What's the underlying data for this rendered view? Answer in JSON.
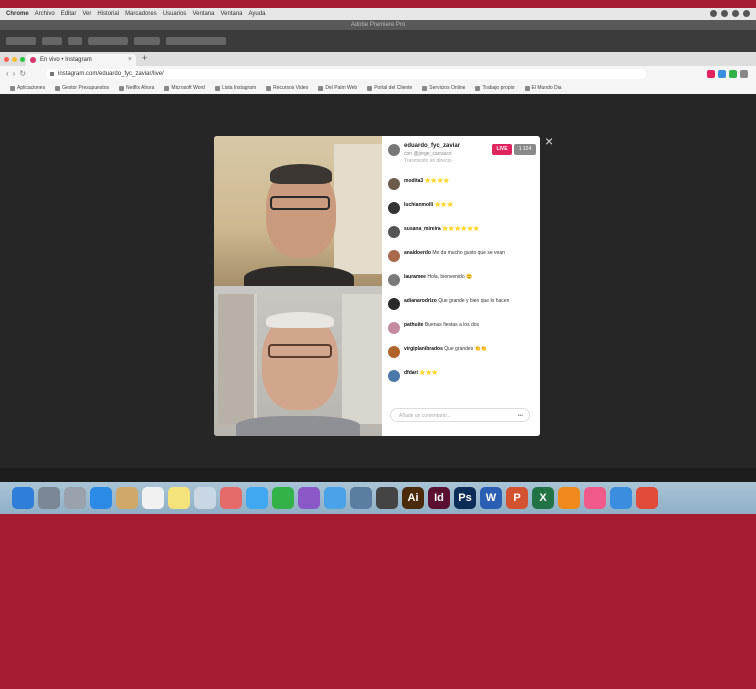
{
  "menubar": {
    "items": [
      "Chrome",
      "Archivo",
      "Editar",
      "Ver",
      "Historial",
      "Marcadores",
      "Usuarios",
      "Ventana",
      "Ventana",
      "Ayuda"
    ]
  },
  "app": {
    "title": "Adobe Premiere Pro"
  },
  "browser": {
    "tab_title": "En vivo • Instagram",
    "url": "instagram.com/eduardo_fyc_zaviar/live/",
    "bookmarks": [
      "Aplicaciones",
      "Gestor Presupuestos",
      "Netflix Ahora",
      "Microsoft Word",
      "Lista Instagram",
      "Recursos Video",
      "Del Palm Web",
      "Portal del Cliente",
      "Servicios Online",
      "Trabajo propio",
      "El Mundo Dia"
    ]
  },
  "live": {
    "host_name": "eduardo_fyc_zaviar",
    "host_sub": "con @jorge_carrasco",
    "host_sub2": "Trasmisión en directo",
    "live_label": "LIVE",
    "viewers_label": "1 124",
    "comments": [
      {
        "user": "modita3",
        "text": "⭐⭐⭐⭐"
      },
      {
        "user": "luchianmolli",
        "text": "⭐⭐⭐"
      },
      {
        "user": "susana_mireira",
        "text": "⭐⭐⭐⭐⭐⭐"
      },
      {
        "user": "anaidoerdo",
        "text": "Me da mucho gusto que se vean"
      },
      {
        "user": "lauramee",
        "text": "Hola, bienvenido 😊"
      },
      {
        "user": "adianarodrizo",
        "text": "Que grande y bien que lo hacen"
      },
      {
        "user": "pathuite",
        "text": "Buenas fiestas a los dos"
      },
      {
        "user": "virgiplanibrados",
        "text": "Que grandes 👏👏"
      },
      {
        "user": "dfdari",
        "text": "⭐⭐⭐"
      }
    ],
    "comment_placeholder": "Añade un comentario...",
    "comment_more": "•••"
  },
  "dock": {
    "icons": [
      {
        "name": "finder-icon",
        "color": "#2f7fd8",
        "glyph": ""
      },
      {
        "name": "launchpad-icon",
        "color": "#7b8794",
        "glyph": ""
      },
      {
        "name": "system-prefs-icon",
        "color": "#9aa3ad",
        "glyph": ""
      },
      {
        "name": "safari-icon",
        "color": "#2b8ae6",
        "glyph": ""
      },
      {
        "name": "notes-icon",
        "color": "#d0a867",
        "glyph": ""
      },
      {
        "name": "calendar-icon",
        "color": "#f1f1f1",
        "glyph": ""
      },
      {
        "name": "stickies-icon",
        "color": "#f4e27a",
        "glyph": ""
      },
      {
        "name": "preview-icon",
        "color": "#c9d6e3",
        "glyph": ""
      },
      {
        "name": "photos-icon",
        "color": "#e56b6b",
        "glyph": ""
      },
      {
        "name": "messages-icon",
        "color": "#3fa8f0",
        "glyph": ""
      },
      {
        "name": "facetime-icon",
        "color": "#34b24a",
        "glyph": ""
      },
      {
        "name": "imovie-icon",
        "color": "#8a59c7",
        "glyph": ""
      },
      {
        "name": "app-store-icon",
        "color": "#4aa3e8",
        "glyph": ""
      },
      {
        "name": "screen-icon",
        "color": "#5b7da1",
        "glyph": ""
      },
      {
        "name": "drive-icon",
        "color": "#444444",
        "glyph": ""
      },
      {
        "name": "illustrator-icon",
        "color": "#4a2a0a",
        "glyph": "Ai"
      },
      {
        "name": "indesign-icon",
        "color": "#5a1030",
        "glyph": "Id"
      },
      {
        "name": "photoshop-icon",
        "color": "#0c2d58",
        "glyph": "Ps"
      },
      {
        "name": "word-icon",
        "color": "#2b5fb3",
        "glyph": "W"
      },
      {
        "name": "powerpoint-icon",
        "color": "#d35230",
        "glyph": "P"
      },
      {
        "name": "excel-icon",
        "color": "#217346",
        "glyph": "X"
      },
      {
        "name": "vlc-icon",
        "color": "#f08a1c",
        "glyph": ""
      },
      {
        "name": "itunes-icon",
        "color": "#f05a8a",
        "glyph": ""
      },
      {
        "name": "app-icon",
        "color": "#3b8de0",
        "glyph": ""
      },
      {
        "name": "chrome-icon",
        "color": "#e04b3a",
        "glyph": ""
      }
    ]
  },
  "colors": {
    "brand_red": "#a61c30",
    "live_pink": "#e0245e"
  }
}
